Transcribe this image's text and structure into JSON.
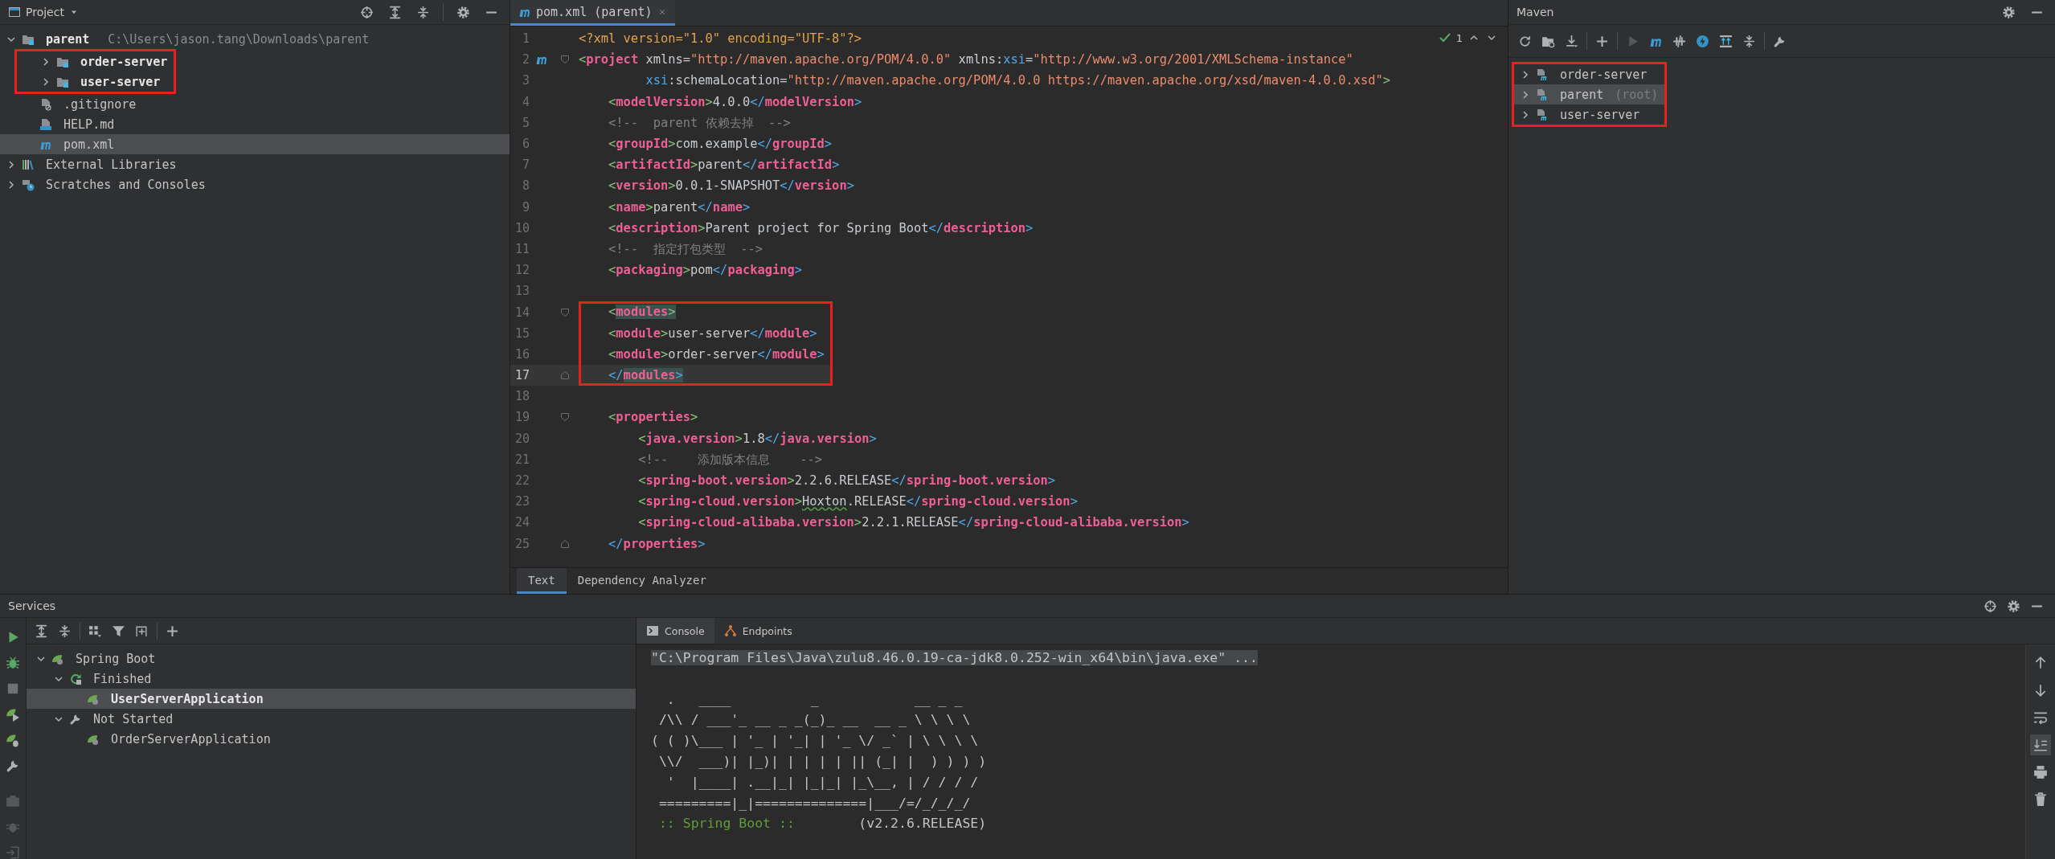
{
  "project_panel": {
    "title": "Project",
    "tree": [
      {
        "label": "parent",
        "path": "C:\\Users\\jason.tang\\Downloads\\parent",
        "kind": "module",
        "expanded": true,
        "selected": false,
        "marked": false,
        "children": [
          {
            "label": "order-server",
            "kind": "module",
            "expanded": false,
            "selected": false,
            "marked": true
          },
          {
            "label": "user-server",
            "kind": "module",
            "expanded": false,
            "selected": false,
            "marked": true
          },
          {
            "label": ".gitignore",
            "kind": "ignore-file",
            "selected": false,
            "marked": false
          },
          {
            "label": "HELP.md",
            "kind": "markdown",
            "selected": false,
            "marked": false
          },
          {
            "label": "pom.xml",
            "kind": "maven",
            "selected": true,
            "marked": false
          }
        ]
      },
      {
        "label": "External Libraries",
        "kind": "libraries",
        "expanded": false,
        "selected": false,
        "marked": false
      },
      {
        "label": "Scratches and Consoles",
        "kind": "scratches",
        "expanded": false,
        "selected": false,
        "marked": false
      }
    ]
  },
  "editor": {
    "tabs": [
      {
        "label": "pom.xml (parent)",
        "selected": true
      }
    ],
    "problem_count": "1",
    "lines": [
      {
        "number": "1",
        "current": false,
        "marked": false,
        "segments": [
          {
            "kind": "decl",
            "text": "<?xml version=\"1.0\" encoding=\"UTF-8\"?>"
          }
        ]
      },
      {
        "number": "2",
        "current": false,
        "marked": false,
        "gutter_mark": true,
        "fold_start": true,
        "segments": [
          {
            "kind": "lt",
            "text": "<"
          },
          {
            "kind": "tag",
            "text": "project"
          },
          {
            "kind": "attr",
            "text": " xmlns="
          },
          {
            "kind": "value",
            "text": "\"http://maven.apache.org/POM/4.0.0\""
          },
          {
            "kind": "attr",
            "text": " xmlns:"
          },
          {
            "kind": "ns",
            "text": "xsi"
          },
          {
            "kind": "attr",
            "text": "="
          },
          {
            "kind": "value",
            "text": "\"http://www.w3.org/2001/XMLSchema-instance\""
          }
        ]
      },
      {
        "number": "3",
        "current": false,
        "marked": false,
        "segments": [
          {
            "kind": "ns",
            "text": "         xsi"
          },
          {
            "kind": "attr",
            "text": ":schemaLocation="
          },
          {
            "kind": "value",
            "text": "\"http://maven.apache.org/POM/4.0.0 https://maven.apache.org/xsd/maven-4.0.0.xsd\""
          },
          {
            "kind": "lt",
            "text": ">"
          }
        ]
      },
      {
        "number": "4",
        "current": false,
        "marked": false,
        "segments": [
          {
            "kind": "lt",
            "text": "    <"
          },
          {
            "kind": "tag",
            "text": "modelVersion"
          },
          {
            "kind": "lt",
            "text": ">"
          },
          {
            "kind": "text",
            "text": "4.0.0"
          },
          {
            "kind": "end",
            "text": "</"
          },
          {
            "kind": "tag",
            "text": "modelVersion"
          },
          {
            "kind": "end",
            "text": ">"
          }
        ]
      },
      {
        "number": "5",
        "current": false,
        "marked": false,
        "segments": [
          {
            "kind": "comment",
            "text": "    <!--  parent 依赖去掉  -->"
          }
        ]
      },
      {
        "number": "6",
        "current": false,
        "marked": false,
        "segments": [
          {
            "kind": "lt",
            "text": "    <"
          },
          {
            "kind": "tag",
            "text": "groupId"
          },
          {
            "kind": "lt",
            "text": ">"
          },
          {
            "kind": "text",
            "text": "com.example"
          },
          {
            "kind": "end",
            "text": "</"
          },
          {
            "kind": "tag",
            "text": "groupId"
          },
          {
            "kind": "end",
            "text": ">"
          }
        ]
      },
      {
        "number": "7",
        "current": false,
        "marked": false,
        "segments": [
          {
            "kind": "lt",
            "text": "    <"
          },
          {
            "kind": "tag",
            "text": "artifactId"
          },
          {
            "kind": "lt",
            "text": ">"
          },
          {
            "kind": "text",
            "text": "parent"
          },
          {
            "kind": "end",
            "text": "</"
          },
          {
            "kind": "tag",
            "text": "artifactId"
          },
          {
            "kind": "end",
            "text": ">"
          }
        ]
      },
      {
        "number": "8",
        "current": false,
        "marked": false,
        "segments": [
          {
            "kind": "lt",
            "text": "    <"
          },
          {
            "kind": "tag",
            "text": "version"
          },
          {
            "kind": "lt",
            "text": ">"
          },
          {
            "kind": "text",
            "text": "0.0.1-SNAPSHOT"
          },
          {
            "kind": "end",
            "text": "</"
          },
          {
            "kind": "tag",
            "text": "version"
          },
          {
            "kind": "end",
            "text": ">"
          }
        ]
      },
      {
        "number": "9",
        "current": false,
        "marked": false,
        "segments": [
          {
            "kind": "lt",
            "text": "    <"
          },
          {
            "kind": "tag",
            "text": "name"
          },
          {
            "kind": "lt",
            "text": ">"
          },
          {
            "kind": "text",
            "text": "parent"
          },
          {
            "kind": "end",
            "text": "</"
          },
          {
            "kind": "tag",
            "text": "name"
          },
          {
            "kind": "end",
            "text": ">"
          }
        ]
      },
      {
        "number": "10",
        "current": false,
        "marked": false,
        "segments": [
          {
            "kind": "lt",
            "text": "    <"
          },
          {
            "kind": "tag",
            "text": "description"
          },
          {
            "kind": "lt",
            "text": ">"
          },
          {
            "kind": "text",
            "text": "Parent project for Spring Boot"
          },
          {
            "kind": "end",
            "text": "</"
          },
          {
            "kind": "tag",
            "text": "description"
          },
          {
            "kind": "end",
            "text": ">"
          }
        ]
      },
      {
        "number": "11",
        "current": false,
        "marked": false,
        "segments": [
          {
            "kind": "comment",
            "text": "    <!--  指定打包类型  -->"
          }
        ]
      },
      {
        "number": "12",
        "current": false,
        "marked": false,
        "segments": [
          {
            "kind": "lt",
            "text": "    <"
          },
          {
            "kind": "tag",
            "text": "packaging"
          },
          {
            "kind": "lt",
            "text": ">"
          },
          {
            "kind": "text",
            "text": "pom"
          },
          {
            "kind": "end",
            "text": "</"
          },
          {
            "kind": "tag",
            "text": "packaging"
          },
          {
            "kind": "end",
            "text": ">"
          }
        ]
      },
      {
        "number": "13",
        "current": false
      },
      {
        "number": "14",
        "current": false,
        "marked": true,
        "fold_start": true,
        "segments": [
          {
            "kind": "lt",
            "text": "    <"
          },
          {
            "kind": "tag",
            "text": "modules",
            "matched": true
          },
          {
            "kind": "lt",
            "text": ">",
            "matched": true
          }
        ]
      },
      {
        "number": "15",
        "current": false,
        "marked": true,
        "segments": [
          {
            "kind": "lt",
            "text": "    <"
          },
          {
            "kind": "tag",
            "text": "module"
          },
          {
            "kind": "lt",
            "text": ">"
          },
          {
            "kind": "text",
            "text": "user-server"
          },
          {
            "kind": "end",
            "text": "</"
          },
          {
            "kind": "tag",
            "text": "module"
          },
          {
            "kind": "end",
            "text": ">"
          }
        ]
      },
      {
        "number": "16",
        "current": false,
        "marked": true,
        "segments": [
          {
            "kind": "lt",
            "text": "    <"
          },
          {
            "kind": "tag",
            "text": "module"
          },
          {
            "kind": "lt",
            "text": ">"
          },
          {
            "kind": "text",
            "text": "order-server"
          },
          {
            "kind": "end",
            "text": "</"
          },
          {
            "kind": "tag",
            "text": "module"
          },
          {
            "kind": "end",
            "text": ">"
          }
        ]
      },
      {
        "number": "17",
        "current": true,
        "marked": true,
        "fold_end": true,
        "segments": [
          {
            "kind": "end",
            "text": "    </"
          },
          {
            "kind": "tag",
            "text": "modules",
            "matched": true
          },
          {
            "kind": "end",
            "text": ">",
            "matched": true
          }
        ]
      },
      {
        "number": "18",
        "current": false
      },
      {
        "number": "19",
        "current": false,
        "marked": false,
        "fold_start": true,
        "segments": [
          {
            "kind": "lt",
            "text": "    <"
          },
          {
            "kind": "tag",
            "text": "properties"
          },
          {
            "kind": "lt",
            "text": ">"
          }
        ]
      },
      {
        "number": "20",
        "current": false,
        "marked": false,
        "segments": [
          {
            "kind": "lt",
            "text": "        <"
          },
          {
            "kind": "tag",
            "text": "java.version"
          },
          {
            "kind": "lt",
            "text": ">"
          },
          {
            "kind": "text",
            "text": "1.8"
          },
          {
            "kind": "end",
            "text": "</"
          },
          {
            "kind": "tag",
            "text": "java.version"
          },
          {
            "kind": "end",
            "text": ">"
          }
        ]
      },
      {
        "number": "21",
        "current": false,
        "marked": false,
        "segments": [
          {
            "kind": "comment",
            "text": "        <!--    添加版本信息    -->"
          }
        ]
      },
      {
        "number": "22",
        "current": false,
        "marked": false,
        "segments": [
          {
            "kind": "lt",
            "text": "        <"
          },
          {
            "kind": "tag",
            "text": "spring-boot.version"
          },
          {
            "kind": "lt",
            "text": ">"
          },
          {
            "kind": "text",
            "text": "2.2.6.RELEASE"
          },
          {
            "kind": "end",
            "text": "</"
          },
          {
            "kind": "tag",
            "text": "spring-boot.version"
          },
          {
            "kind": "end",
            "text": ">"
          }
        ]
      },
      {
        "number": "23",
        "current": false,
        "marked": false,
        "segments": [
          {
            "kind": "lt",
            "text": "        <"
          },
          {
            "kind": "tag",
            "text": "spring-cloud.version"
          },
          {
            "kind": "lt",
            "text": ">"
          },
          {
            "kind": "text",
            "text": "Hoxton",
            "typo": true
          },
          {
            "kind": "text",
            "text": ".RELEASE"
          },
          {
            "kind": "end",
            "text": "</"
          },
          {
            "kind": "tag",
            "text": "spring-cloud.version"
          },
          {
            "kind": "end",
            "text": ">"
          }
        ]
      },
      {
        "number": "24",
        "current": false,
        "marked": false,
        "segments": [
          {
            "kind": "lt",
            "text": "        <"
          },
          {
            "kind": "tag",
            "text": "spring-cloud-alibaba.version"
          },
          {
            "kind": "lt",
            "text": ">"
          },
          {
            "kind": "text",
            "text": "2.2.1.RELEASE"
          },
          {
            "kind": "end",
            "text": "</"
          },
          {
            "kind": "tag",
            "text": "spring-cloud-alibaba.version"
          },
          {
            "kind": "end",
            "text": ">"
          }
        ]
      },
      {
        "number": "25",
        "current": false,
        "marked": false,
        "fold_end": true,
        "segments": [
          {
            "kind": "end",
            "text": "    </"
          },
          {
            "kind": "tag",
            "text": "properties"
          },
          {
            "kind": "end",
            "text": ">"
          }
        ]
      }
    ],
    "bottom_tabs": [
      {
        "label": "Text",
        "selected": true
      },
      {
        "label": "Dependency Analyzer",
        "selected": false
      }
    ]
  },
  "maven_panel": {
    "title": "Maven",
    "items": [
      {
        "label": "order-server",
        "expanded": false,
        "selected": false,
        "marked": true
      },
      {
        "label": "parent",
        "suffix": "(root)",
        "expanded": false,
        "selected": true,
        "marked": true
      },
      {
        "label": "user-server",
        "expanded": false,
        "selected": false,
        "marked": true
      }
    ]
  },
  "services_panel": {
    "title": "Services",
    "tree": [
      {
        "label": "Spring Boot",
        "kind": "spring",
        "expanded": true,
        "selected": false,
        "children": [
          {
            "label": "Finished",
            "kind": "finished",
            "expanded": true,
            "selected": false,
            "children": [
              {
                "label": "UserServerApplication",
                "kind": "app",
                "selected": true
              }
            ]
          },
          {
            "label": "Not Started",
            "kind": "not-started",
            "expanded": true,
            "selected": false,
            "children": [
              {
                "label": "OrderServerApplication",
                "kind": "app",
                "selected": false
              }
            ]
          }
        ]
      }
    ],
    "console": {
      "tabs": [
        {
          "label": "Console",
          "selected": true
        },
        {
          "label": "Endpoints",
          "selected": false
        }
      ],
      "command": "\"C:\\Program Files\\Java\\zulu8.46.0.19-ca-jdk8.0.252-win_x64\\bin\\java.exe\" ...",
      "banner": [
        "  .   ____          _            __ _ _",
        " /\\\\ / ___'_ __ _ _(_)_ __  __ _ \\ \\ \\ \\",
        "( ( )\\___ | '_ | '_| | '_ \\/ _` | \\ \\ \\ \\",
        " \\\\/  ___)| |_)| | | | | || (_| |  ) ) ) )",
        "  '  |____| .__|_| |_|_| |_\\__, | / / / /",
        " =========|_|==============|___/=/_/_/_/"
      ],
      "version_line": {
        "label": " :: Spring Boot :: ",
        "version": "       (v2.2.6.RELEASE)"
      }
    }
  }
}
